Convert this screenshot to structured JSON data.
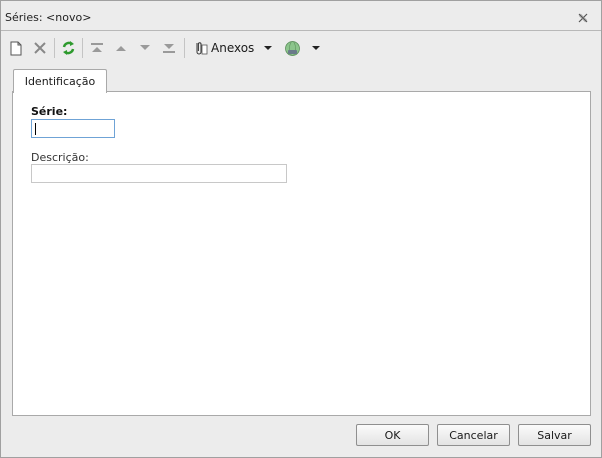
{
  "window": {
    "title": "Séries: <novo>"
  },
  "toolbar": {
    "buttons": [
      {
        "name": "new-icon",
        "tooltip": ""
      },
      {
        "name": "delete-icon",
        "tooltip": ""
      },
      {
        "name": "refresh-icon",
        "tooltip": ""
      },
      {
        "name": "first-record-icon",
        "tooltip": ""
      },
      {
        "name": "previous-record-icon",
        "tooltip": ""
      },
      {
        "name": "next-record-icon",
        "tooltip": ""
      },
      {
        "name": "last-record-icon",
        "tooltip": ""
      }
    ],
    "anexos_label": "Anexos"
  },
  "tabs": [
    {
      "label": "Identificação",
      "active": true
    }
  ],
  "form": {
    "serie_label": "Série:",
    "serie_value": "",
    "descricao_label": "Descrição:",
    "descricao_value": ""
  },
  "footer": {
    "ok_label": "OK",
    "cancel_label": "Cancelar",
    "save_label": "Salvar"
  },
  "colors": {
    "window_bg": "#ececec",
    "panel_bg": "#ffffff",
    "focus_border": "#6fa3d6",
    "refresh_green": "#2e9a2e"
  }
}
